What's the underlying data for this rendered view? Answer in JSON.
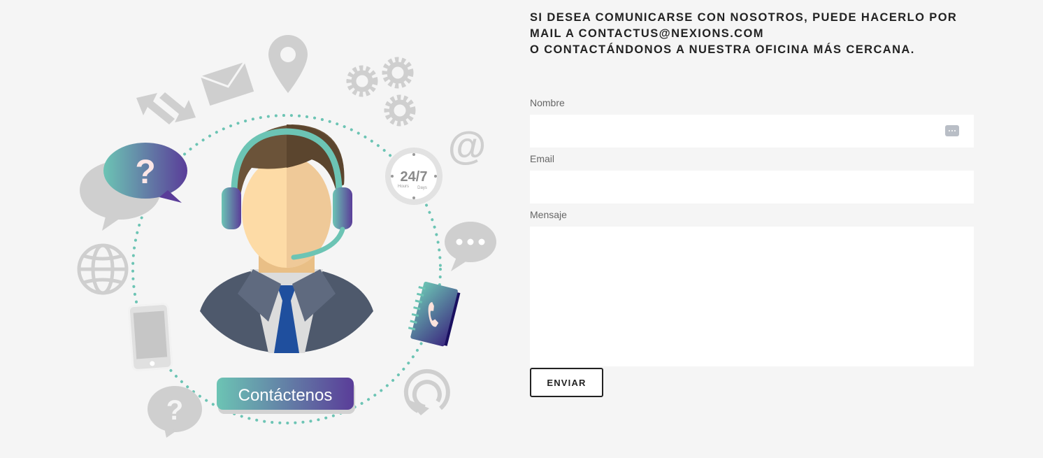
{
  "illustration": {
    "badge_label": "Contáctenos",
    "clock_main": "24/7",
    "clock_left": "Hours",
    "clock_right": "Days",
    "question_mark": "?",
    "at_sign": "@",
    "colors": {
      "teal": "#6cc4b4",
      "purple": "#5a3d99",
      "gray": "#cfcfcf",
      "suit": "#4e596c",
      "tie": "#1f4f9e"
    }
  },
  "contact": {
    "intro_line1": "SI DESEA COMUNICARSE CON NOSOTROS, PUEDE HACERLO POR",
    "intro_line2": "MAIL A CONTACTUS@NEXIONS.COM",
    "intro_line3": "O CONTACTÁNDONOS A NUESTRA OFICINA MÁS CERCANA.",
    "fields": {
      "name_label": "Nombre",
      "name_value": "",
      "email_label": "Email",
      "email_value": "",
      "message_label": "Mensaje",
      "message_value": ""
    },
    "submit_label": "ENVIAR"
  }
}
